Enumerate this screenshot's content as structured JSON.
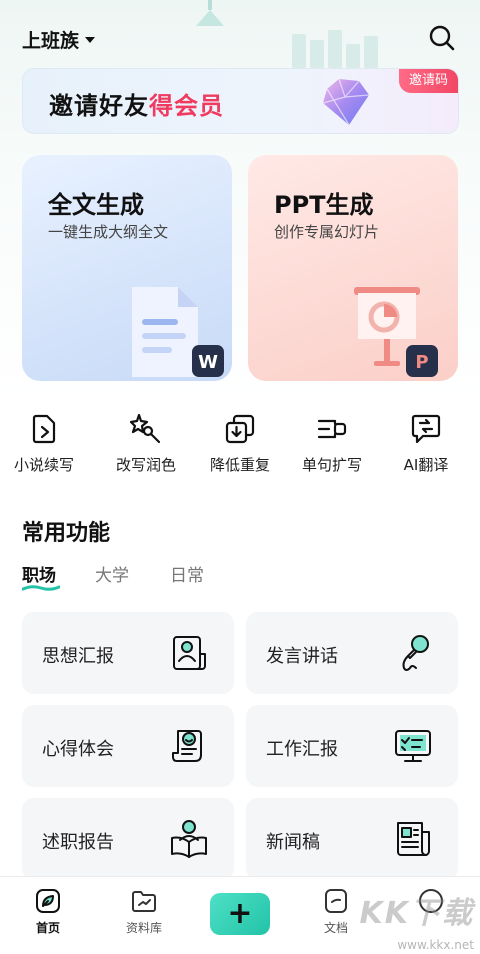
{
  "header": {
    "location": "上班族"
  },
  "banner": {
    "text_black": "邀请好友",
    "text_red": "得会员",
    "tag": "邀请码"
  },
  "cards": [
    {
      "title": "全文生成",
      "subtitle": "一键生成大纲全文",
      "badge": "W"
    },
    {
      "title": "PPT生成",
      "subtitle": "创作专属幻灯片",
      "badge": "P"
    }
  ],
  "tools": [
    {
      "label": "小说续写",
      "icon": "novel-continue-icon"
    },
    {
      "label": "改写润色",
      "icon": "rewrite-polish-icon"
    },
    {
      "label": "降低重复",
      "icon": "reduce-duplicate-icon"
    },
    {
      "label": "单句扩写",
      "icon": "sentence-expand-icon"
    },
    {
      "label": "AI翻译",
      "icon": "ai-translate-icon"
    }
  ],
  "common": {
    "title": "常用功能",
    "tabs": [
      "职场",
      "大学",
      "日常"
    ],
    "active_tab": "职场",
    "items": [
      {
        "label": "思想汇报",
        "icon": "report-person-icon"
      },
      {
        "label": "发言讲话",
        "icon": "microphone-icon"
      },
      {
        "label": "心得体会",
        "icon": "smile-doc-icon"
      },
      {
        "label": "工作汇报",
        "icon": "monitor-check-icon"
      },
      {
        "label": "述职报告",
        "icon": "reader-book-icon"
      },
      {
        "label": "新闻稿",
        "icon": "newspaper-icon"
      }
    ]
  },
  "nav": [
    {
      "label": "首页",
      "icon": "home-leaf-icon",
      "active": true
    },
    {
      "label": "资料库",
      "icon": "folder-icon",
      "active": false
    },
    {
      "label": "+",
      "icon": "add-icon",
      "active": false
    },
    {
      "label": "文档",
      "icon": "document-icon",
      "active": false
    },
    {
      "label": "",
      "icon": "profile-icon",
      "active": false
    }
  ],
  "watermark": {
    "logo": "KK下载",
    "url": "www.kkx.net"
  },
  "colors": {
    "accent": "#2ec9ad",
    "banner_red": "#f03a5f",
    "doc_card": "#cfe0f8",
    "ppt_card": "#fbd3cc"
  }
}
